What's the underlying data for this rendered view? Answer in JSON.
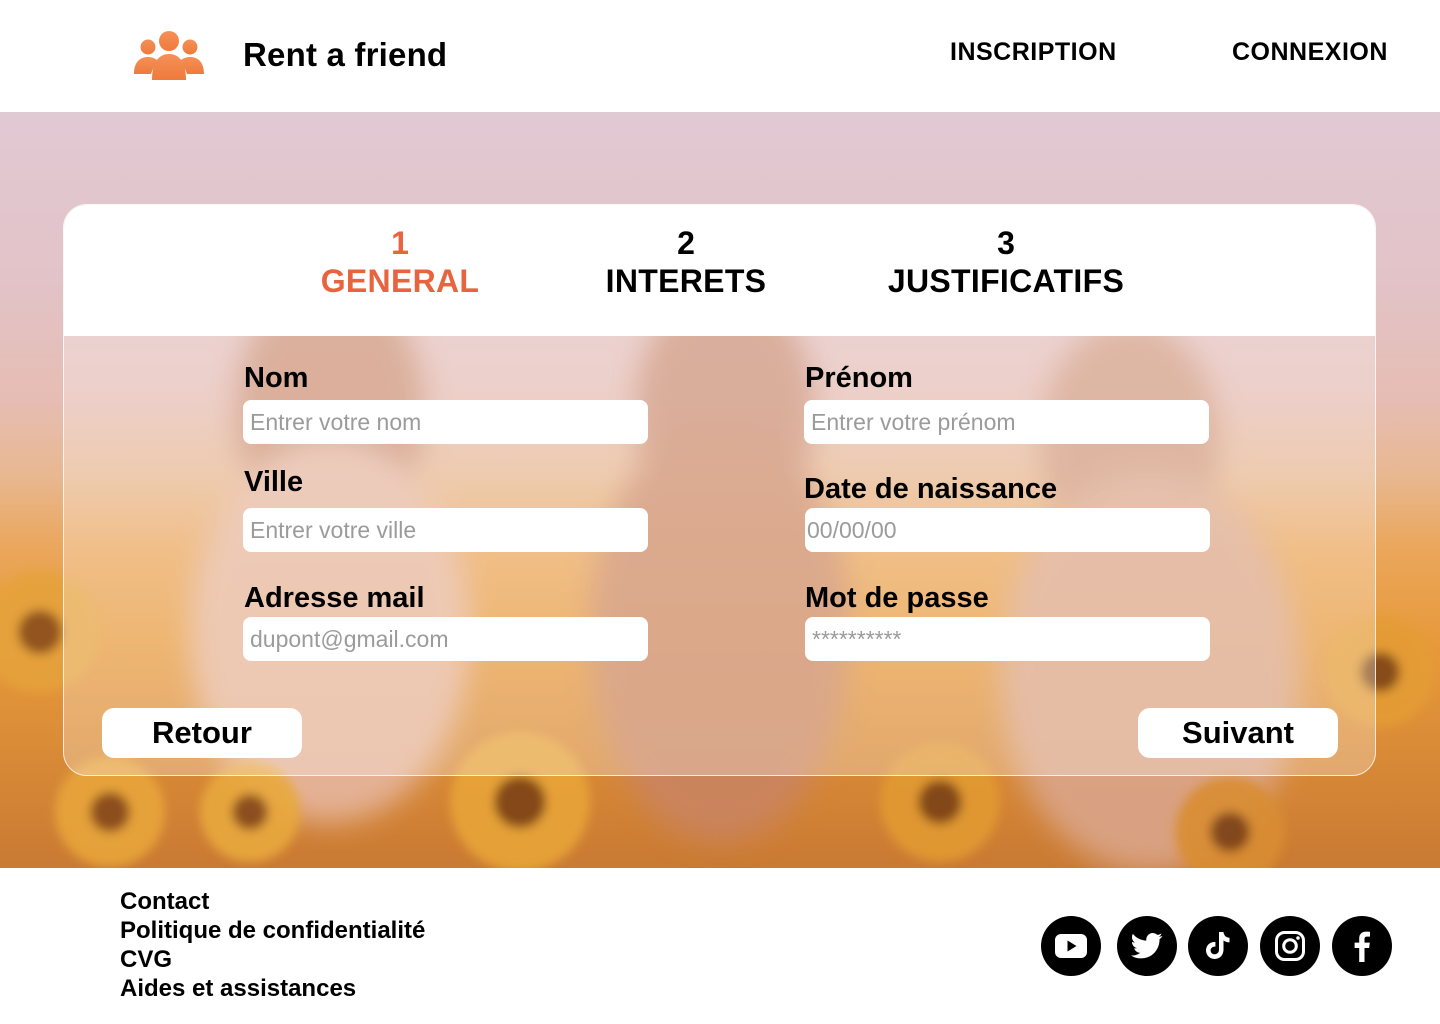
{
  "header": {
    "brand": "Rent a friend",
    "logo_icon": "users-group-icon",
    "nav": {
      "inscription": "INSCRIPTION",
      "connexion": "CONNEXION"
    }
  },
  "steps": [
    {
      "number": "1",
      "label": "GENERAL",
      "active": true
    },
    {
      "number": "2",
      "label": "INTERETS",
      "active": false
    },
    {
      "number": "3",
      "label": "JUSTIFICATIFS",
      "active": false
    }
  ],
  "form": {
    "nom": {
      "label": "Nom",
      "placeholder": "Entrer votre nom"
    },
    "prenom": {
      "label": "Prénom",
      "placeholder": "Entrer votre prénom"
    },
    "ville": {
      "label": "Ville",
      "placeholder": "Entrer votre ville"
    },
    "naissance": {
      "label": "Date de naissance",
      "placeholder": "00/00/00"
    },
    "email": {
      "label": "Adresse mail",
      "placeholder": "dupont@gmail.com"
    },
    "password": {
      "label": "Mot de passe",
      "placeholder": "**********"
    }
  },
  "buttons": {
    "back": "Retour",
    "next": "Suivant"
  },
  "footer": {
    "links": [
      "Contact",
      "Politique de confidentialité",
      "CVG",
      "Aides et assistances"
    ],
    "social": [
      "youtube-icon",
      "twitter-icon",
      "tiktok-icon",
      "instagram-icon",
      "facebook-icon"
    ]
  },
  "colors": {
    "accent": "#e8643f",
    "logo": "#f0834a"
  }
}
